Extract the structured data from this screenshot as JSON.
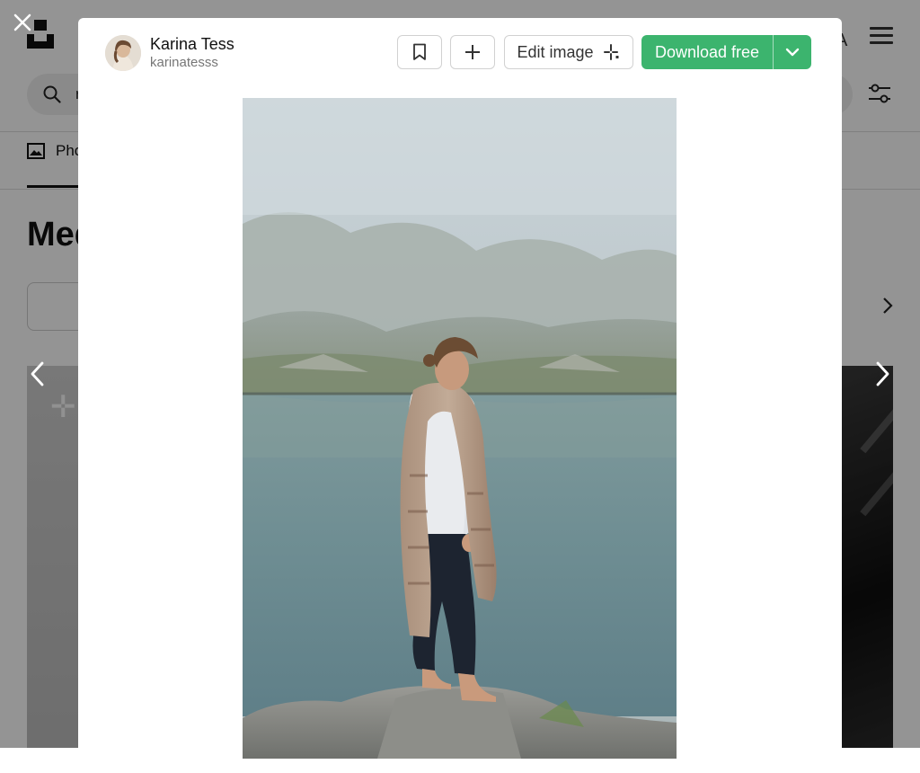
{
  "author": {
    "name": "Karina Tess",
    "handle": "karinatesss"
  },
  "toolbar": {
    "edit_label": "Edit image",
    "download_label": "Download free"
  },
  "background_page": {
    "search_partial": "r",
    "tab_partial": "Pho",
    "heading_partial": "Med",
    "header_letter_partial": "A"
  },
  "colors": {
    "download_green": "#3cb46e",
    "overlay": "rgba(0,0,0,0.42)"
  },
  "icons": {
    "close": "close-icon",
    "bookmark": "bookmark-icon",
    "add": "plus-icon",
    "edit": "sparkle-icon",
    "download_menu": "chevron-down-icon",
    "prev": "chevron-left-icon",
    "next": "chevron-right-icon"
  }
}
